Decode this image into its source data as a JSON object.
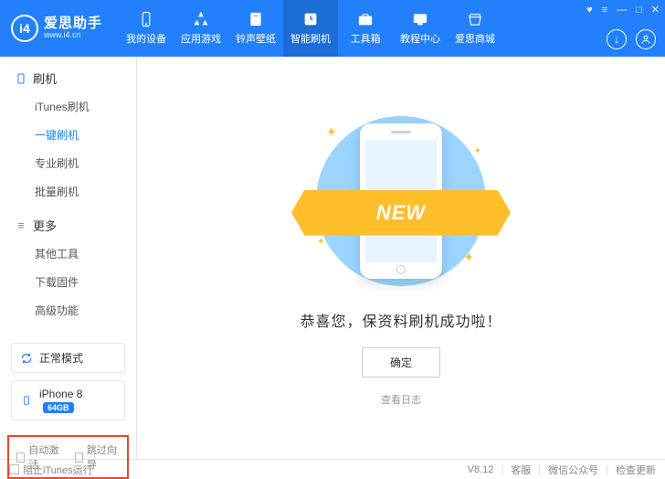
{
  "header": {
    "logo_title": "爱思助手",
    "logo_sub": "www.i4.cn",
    "logo_mark": "i4",
    "nav": [
      {
        "label": "我的设备"
      },
      {
        "label": "应用游戏"
      },
      {
        "label": "铃声壁纸"
      },
      {
        "label": "智能刷机"
      },
      {
        "label": "工具箱"
      },
      {
        "label": "教程中心"
      },
      {
        "label": "爱思商城"
      }
    ]
  },
  "sidebar": {
    "group_flash": "刷机",
    "flash_items": [
      "iTunes刷机",
      "一键刷机",
      "专业刷机",
      "批量刷机"
    ],
    "group_more": "更多",
    "more_items": [
      "其他工具",
      "下载固件",
      "高级功能"
    ],
    "mode_label": "正常模式",
    "device_label": "iPhone 8",
    "storage": "64GB",
    "opt_auto_activate": "自动激活",
    "opt_skip_wizard": "跳过向导"
  },
  "main": {
    "ribbon": "NEW",
    "success": "恭喜您，保资料刷机成功啦！",
    "confirm": "确定",
    "view_log": "查看日志"
  },
  "footer": {
    "block_itunes": "阻止iTunes运行",
    "version": "V8.12",
    "service": "客服",
    "wechat": "微信公众号",
    "update": "检查更新"
  }
}
